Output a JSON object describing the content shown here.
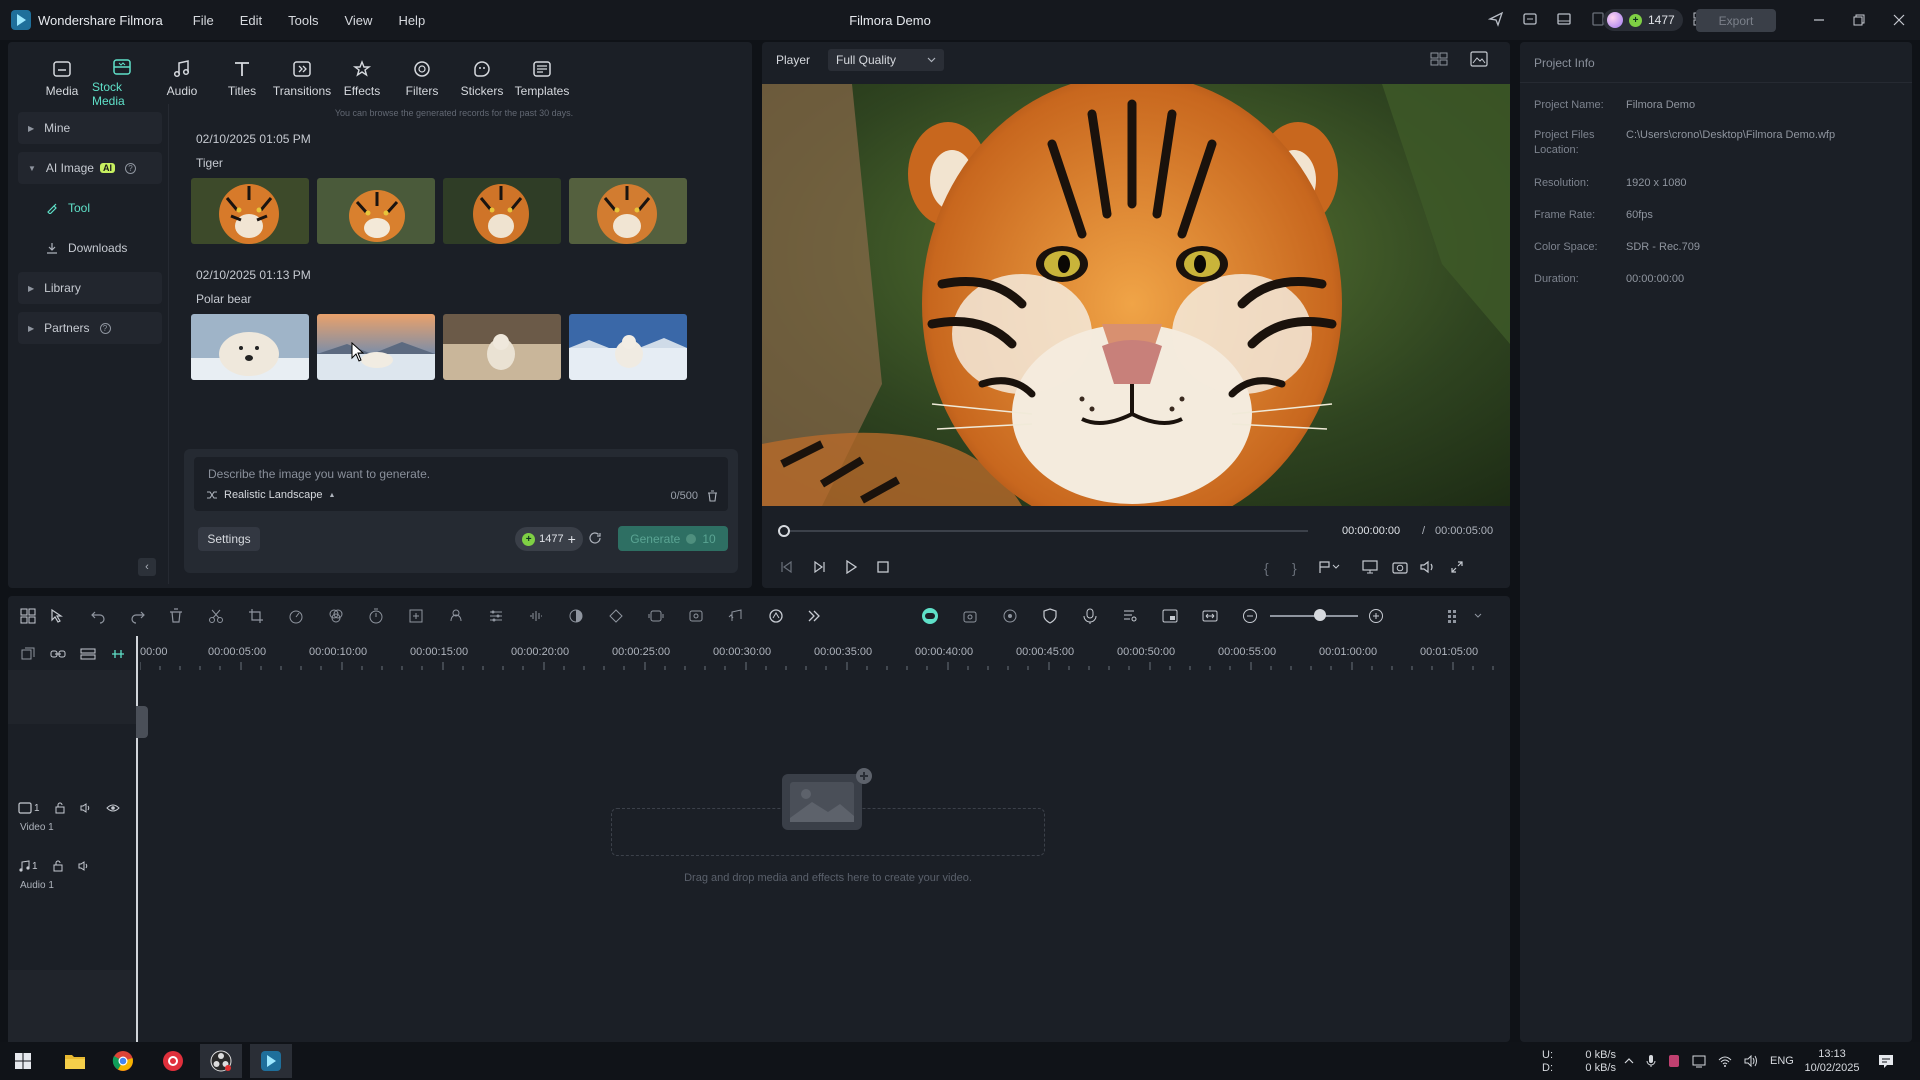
{
  "app": {
    "name": "Wondershare Filmora",
    "window_title": "Filmora Demo",
    "menu": [
      "File",
      "Edit",
      "Tools",
      "View",
      "Help"
    ],
    "credits": "1477",
    "export_label": "Export"
  },
  "toolbar": {
    "tabs": [
      {
        "label": "Media",
        "icon": "media-icon"
      },
      {
        "label": "Stock Media",
        "icon": "stock-media-icon",
        "active": true
      },
      {
        "label": "Audio",
        "icon": "audio-icon"
      },
      {
        "label": "Titles",
        "icon": "titles-icon"
      },
      {
        "label": "Transitions",
        "icon": "transitions-icon"
      },
      {
        "label": "Effects",
        "icon": "effects-icon"
      },
      {
        "label": "Filters",
        "icon": "filters-icon"
      },
      {
        "label": "Stickers",
        "icon": "stickers-icon"
      },
      {
        "label": "Templates",
        "icon": "templates-icon"
      }
    ]
  },
  "sidebar": {
    "items": [
      {
        "label": "Mine"
      },
      {
        "label": "AI Image",
        "badge": "AI"
      },
      {
        "label": "Tool"
      },
      {
        "label": "Downloads"
      },
      {
        "label": "Library"
      },
      {
        "label": "Partners"
      }
    ]
  },
  "ai_image": {
    "browse_note": "You can browse the generated records for the past 30 days.",
    "groups": [
      {
        "date": "02/10/2025 01:05 PM",
        "title": "Tiger"
      },
      {
        "date": "02/10/2025 01:13 PM",
        "title": "Polar bear"
      }
    ],
    "prompt_placeholder": "Describe the image you want to generate.",
    "style": "Realistic Landscape",
    "char_count": "0/500",
    "settings_label": "Settings",
    "credits": "1477",
    "generate_label": "Generate",
    "generate_cost": "10"
  },
  "player": {
    "label": "Player",
    "quality": "Full Quality",
    "current_time": "00:00:00:00",
    "separator": "/",
    "total_time": "00:00:05:00"
  },
  "project_info": {
    "title": "Project Info",
    "rows": [
      {
        "key": "Project Name:",
        "value": "Filmora Demo"
      },
      {
        "key": "Project Files Location:",
        "value": "C:\\Users\\crono\\Desktop\\Filmora Demo.wfp"
      },
      {
        "key": "Resolution:",
        "value": "1920 x 1080"
      },
      {
        "key": "Frame Rate:",
        "value": "60fps"
      },
      {
        "key": "Color Space:",
        "value": "SDR - Rec.709"
      },
      {
        "key": "Duration:",
        "value": "00:00:00:00"
      }
    ]
  },
  "timeline": {
    "ruler": [
      "00:00",
      "00:00:05:00",
      "00:00:10:00",
      "00:00:15:00",
      "00:00:20:00",
      "00:00:25:00",
      "00:00:30:00",
      "00:00:35:00",
      "00:00:40:00",
      "00:00:45:00",
      "00:00:50:00",
      "00:00:55:00",
      "00:01:00:00",
      "00:01:05:00"
    ],
    "tracks": [
      {
        "name": "Video 1",
        "num": "1"
      },
      {
        "name": "Audio 1",
        "num": "1"
      }
    ],
    "drop_hint": "Drag and drop media and effects here to create your video."
  },
  "taskbar": {
    "net_up_label": "U:",
    "net_down_label": "D:",
    "net_up": "0 kB/s",
    "net_down": "0 kB/s",
    "lang": "ENG",
    "time": "13:13",
    "date": "10/02/2025"
  },
  "colors": {
    "accent": "#5fe0c8",
    "panel": "#1b1f26",
    "background": "#0f1217"
  }
}
